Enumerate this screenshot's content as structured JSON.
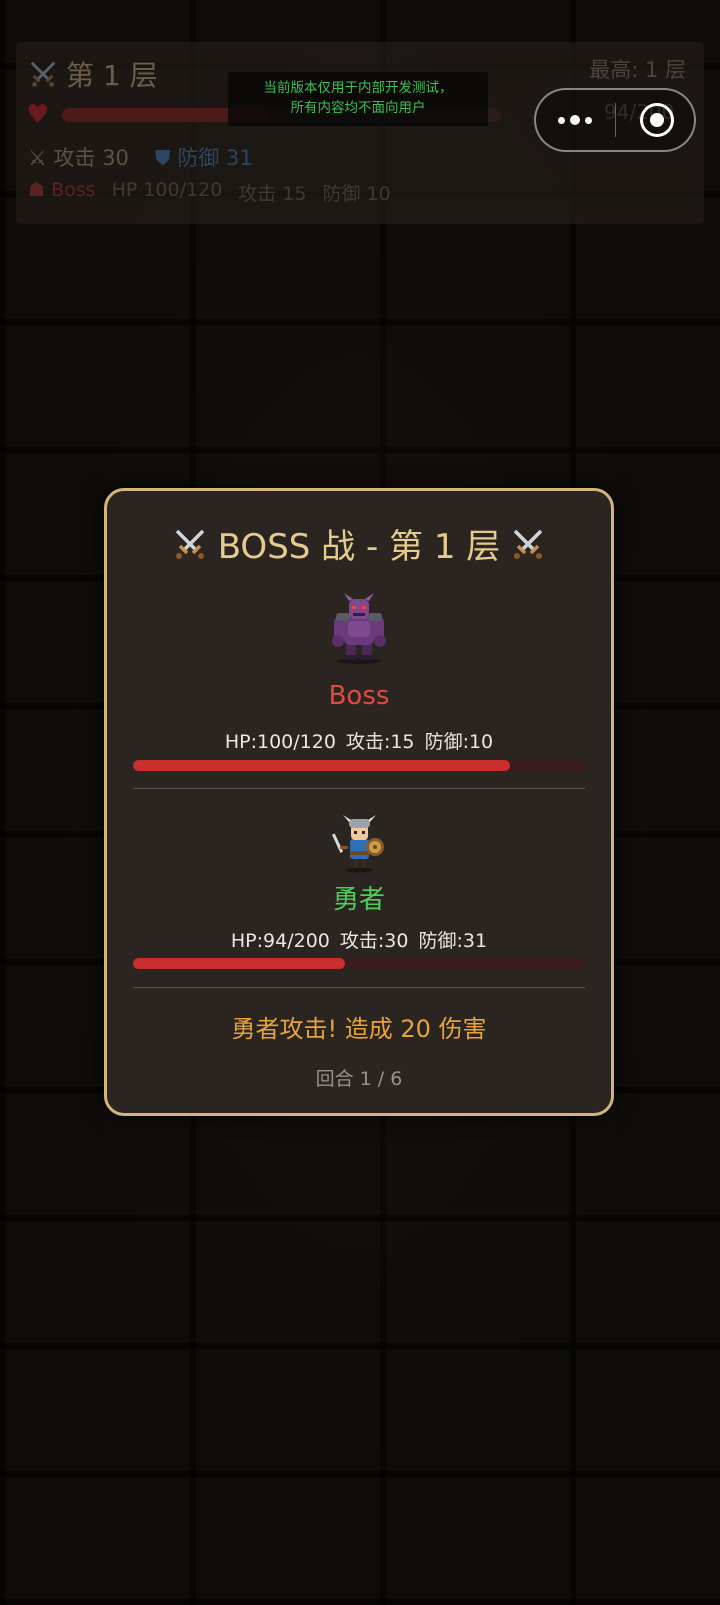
{
  "hud": {
    "title": "第 1 层",
    "best": "最高: 1 层",
    "hero_hp_text": "94/200",
    "hero_hp_fraction": 0.47,
    "attack": "攻击 30",
    "defense": "防御 31",
    "boss_label": "Boss",
    "boss_hp": "HP 100/120",
    "boss_attack": "攻击 15",
    "boss_defense": "防御 10"
  },
  "notice": {
    "line1": "当前版本仅用于内部开发测试，",
    "line2": "所有内容均不面向用户"
  },
  "battle": {
    "title": "BOSS 战 - 第 1 层",
    "boss": {
      "name": "Boss",
      "stats": "HP:100/120  攻击:15  防御:10",
      "hp_fraction": 0.833
    },
    "hero": {
      "name": "勇者",
      "stats": "HP:94/200  攻击:30  防御:31",
      "hp_fraction": 0.47
    },
    "log": "勇者攻击! 造成 20 伤害",
    "round": "回合 1 / 6"
  },
  "colors": {
    "accent_gold": "#d2b47c",
    "boss_red": "#e04a45",
    "hero_green": "#4fcf5a",
    "log_orange": "#e8a33a",
    "hp_red": "#c92f2f"
  }
}
